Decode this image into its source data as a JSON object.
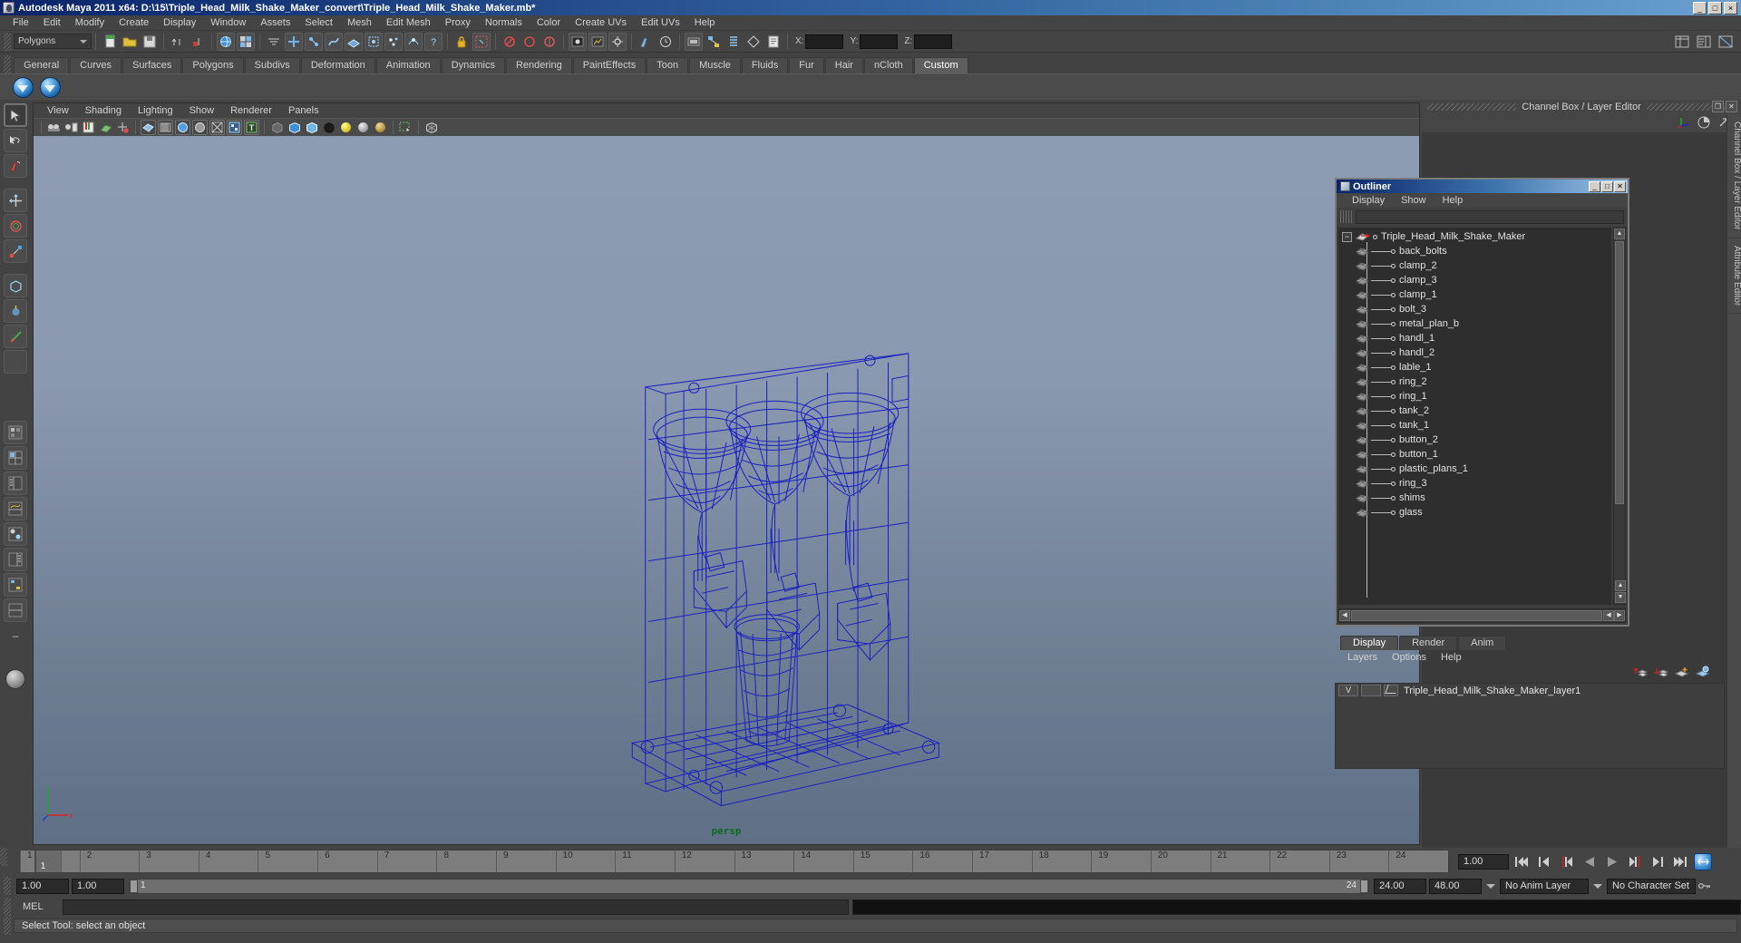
{
  "window": {
    "title": "Autodesk Maya 2011 x64: D:\\15\\Triple_Head_Milk_Shake_Maker_convert\\Triple_Head_Milk_Shake_Maker.mb*",
    "minimize": "_",
    "maximize": "□",
    "close": "×"
  },
  "menubar": {
    "items": [
      "File",
      "Edit",
      "Modify",
      "Create",
      "Display",
      "Window",
      "Assets",
      "Select",
      "Mesh",
      "Edit Mesh",
      "Proxy",
      "Normals",
      "Color",
      "Create UVs",
      "Edit UVs",
      "Help"
    ]
  },
  "statusline": {
    "selection_mode": "Polygons",
    "axis_labels": [
      "X:",
      "Y:",
      "Z:"
    ],
    "axis_values": [
      "",
      "",
      ""
    ]
  },
  "shelf": {
    "tabs": [
      "General",
      "Curves",
      "Surfaces",
      "Polygons",
      "Subdivs",
      "Deformation",
      "Animation",
      "Dynamics",
      "Rendering",
      "PaintEffects",
      "Toon",
      "Muscle",
      "Fluids",
      "Fur",
      "Hair",
      "nCloth",
      "Custom"
    ],
    "active_tab": "Custom",
    "buttons": [
      "blue-orb-icon",
      "blue-orb-icon"
    ]
  },
  "viewport": {
    "menus": [
      "View",
      "Shading",
      "Lighting",
      "Show",
      "Renderer",
      "Panels"
    ],
    "camera_label": "persp",
    "axis_labels": {
      "y": "y",
      "x": "x",
      "z": "z"
    }
  },
  "channelbox": {
    "header": "Channel Box / Layer Editor",
    "restore": "❐",
    "close": "✕",
    "vertical_tabs": [
      "Channel Box / Layer Editor",
      "Attribute Editor"
    ]
  },
  "outliner": {
    "title": "Outliner",
    "minimize": "_",
    "maximize": "□",
    "close": "✕",
    "menus": [
      "Display",
      "Show",
      "Help"
    ],
    "search_value": "",
    "root": "Triple_Head_Milk_Shake_Maker",
    "expander": "−",
    "children": [
      "back_bolts",
      "clamp_2",
      "clamp_3",
      "clamp_1",
      "bolt_3",
      "metal_plan_b",
      "handl_1",
      "handl_2",
      "lable_1",
      "ring_2",
      "ring_1",
      "tank_2",
      "tank_1",
      "button_2",
      "button_1",
      "plastic_plans_1",
      "ring_3",
      "shims",
      "glass"
    ]
  },
  "layereditor": {
    "tabs": [
      "Display",
      "Render",
      "Anim"
    ],
    "active_tab": "Display",
    "menus": [
      "Layers",
      "Options",
      "Help"
    ],
    "layers": [
      {
        "visibility": "V",
        "type": "",
        "name": "Triple_Head_Milk_Shake_Maker_layer1"
      }
    ]
  },
  "timeline": {
    "frames": [
      "1",
      "2",
      "3",
      "4",
      "5",
      "6",
      "7",
      "8",
      "9",
      "10",
      "11",
      "12",
      "13",
      "14",
      "15",
      "16",
      "17",
      "18",
      "19",
      "20",
      "21",
      "22",
      "23",
      "24"
    ],
    "current_frame": "1",
    "current_field": "1.00"
  },
  "rangeslider": {
    "start_field": "1.00",
    "start2_field": "1.00",
    "range_start_label": "1",
    "range_end_label": "24",
    "end_field": "24.00",
    "playback_end_field": "48.00",
    "anim_layer": "No Anim Layer",
    "character_set": "No Character Set"
  },
  "commandline": {
    "language": "MEL",
    "input_value": "",
    "output_value": ""
  },
  "helpline": {
    "text": "Select Tool: select an object"
  },
  "colors": {
    "wireframe": "#1a22c0",
    "viewport_top": "#8d9cb2",
    "viewport_bottom": "#5f6f86",
    "camera_label": "#0a6b1e",
    "titlebar": "#0a246a"
  }
}
